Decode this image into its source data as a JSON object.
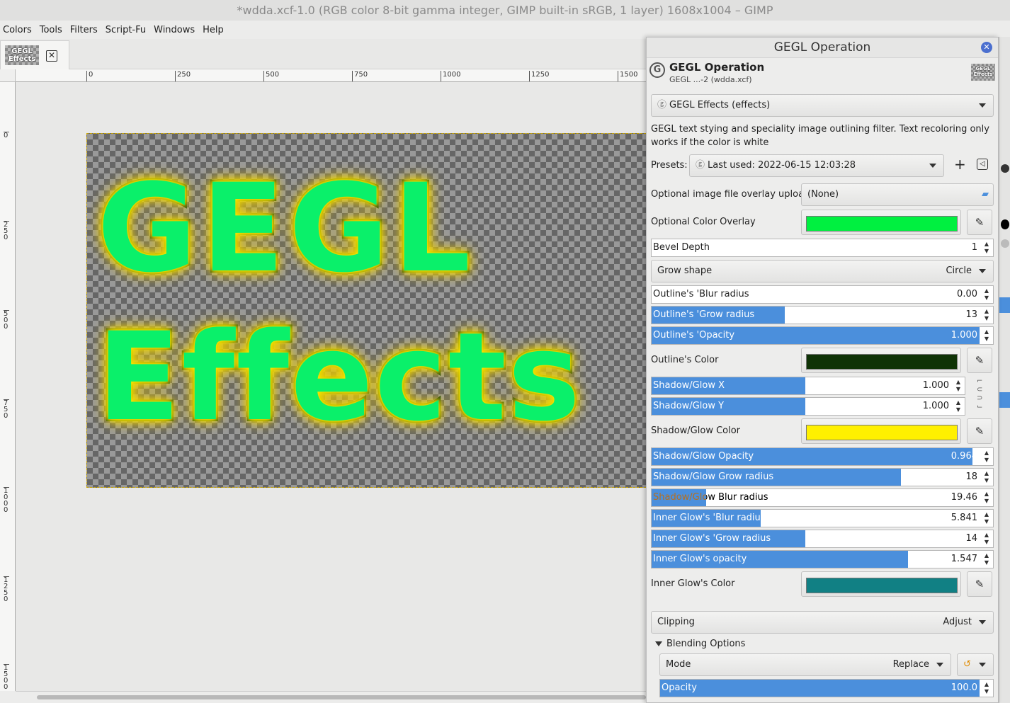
{
  "window": {
    "title": "*wdda.xcf-1.0 (RGB color 8-bit gamma integer, GIMP built-in sRGB, 1 layer) 1608x1004 – GIMP"
  },
  "menu": [
    "Colors",
    "Tools",
    "Filters",
    "Script-Fu",
    "Windows",
    "Help"
  ],
  "tab": {
    "thumb_text": "GEGL Effects",
    "close_icon": "close-icon"
  },
  "ruler_h": [
    "0",
    "250",
    "500",
    "750",
    "1000",
    "1250",
    "1500"
  ],
  "ruler_v": [
    "0",
    "250",
    "500",
    "750",
    "1000",
    "1250",
    "1500"
  ],
  "canvas": {
    "line1": "GEGL",
    "line2": "Effects"
  },
  "dialog": {
    "title": "GEGL Operation",
    "header_title": "GEGL Operation",
    "header_sub": "GEGL ...-2 (wdda.xcf)",
    "header_thumb": "GEGL Effects",
    "operation": "GEGL Effects (effects)",
    "description": "GEGL text stying and speciality image outlining filter. Text recoloring only works if the color is white",
    "presets_label": "Presets:",
    "presets_value": "Last used: 2022-06-15 12:03:28",
    "overlay_upload_label": "Optional image file overlay upload",
    "overlay_upload_value": "(None)",
    "color_overlay_label": "Optional Color Overlay",
    "color_overlay": "#00f040",
    "bevel_label": "Bevel Depth",
    "bevel_value": "1",
    "grow_shape_label": "Grow shape",
    "grow_shape_value": "Circle",
    "outline_blur_label": "Outline's 'Blur radius",
    "outline_blur_value": "0.00",
    "outline_grow_label": "Outline's 'Grow radius",
    "outline_grow_value": "13",
    "outline_opacity_label": "Outline's 'Opacity",
    "outline_opacity_value": "1.000",
    "outline_color_label": "Outline's Color",
    "outline_color": "#0f3306",
    "shadow_x_label": "Shadow/Glow X",
    "shadow_x_value": "1.000",
    "shadow_y_label": "Shadow/Glow Y",
    "shadow_y_value": "1.000",
    "shadow_color_label": "Shadow/Glow Color",
    "shadow_color": "#fff000",
    "shadow_opacity_label": "Shadow/Glow Opacity",
    "shadow_opacity_value": "0.964",
    "shadow_grow_label": "Shadow/Glow Grow radius",
    "shadow_grow_value": "18",
    "shadow_blur_label": "Shadow/Glow Blur radius",
    "shadow_blur_value": "19.46",
    "inner_blur_label": "Inner Glow's 'Blur radius",
    "inner_blur_value": "5.841",
    "inner_grow_label": "Inner Glow's 'Grow radius",
    "inner_grow_value": "14",
    "inner_opacity_label": "Inner Glow's opacity",
    "inner_opacity_value": "1.547",
    "inner_color_label": "Inner Glow's Color",
    "inner_color": "#118084",
    "clipping_label": "Clipping",
    "clipping_value": "Adjust",
    "blending_label": "Blending Options",
    "mode_label": "Mode",
    "mode_value": "Replace",
    "opacity_label": "Opacity",
    "opacity_value": "100.0"
  },
  "colors": {
    "accent": "#4b8fdc",
    "dialog_bg": "#ededec"
  }
}
